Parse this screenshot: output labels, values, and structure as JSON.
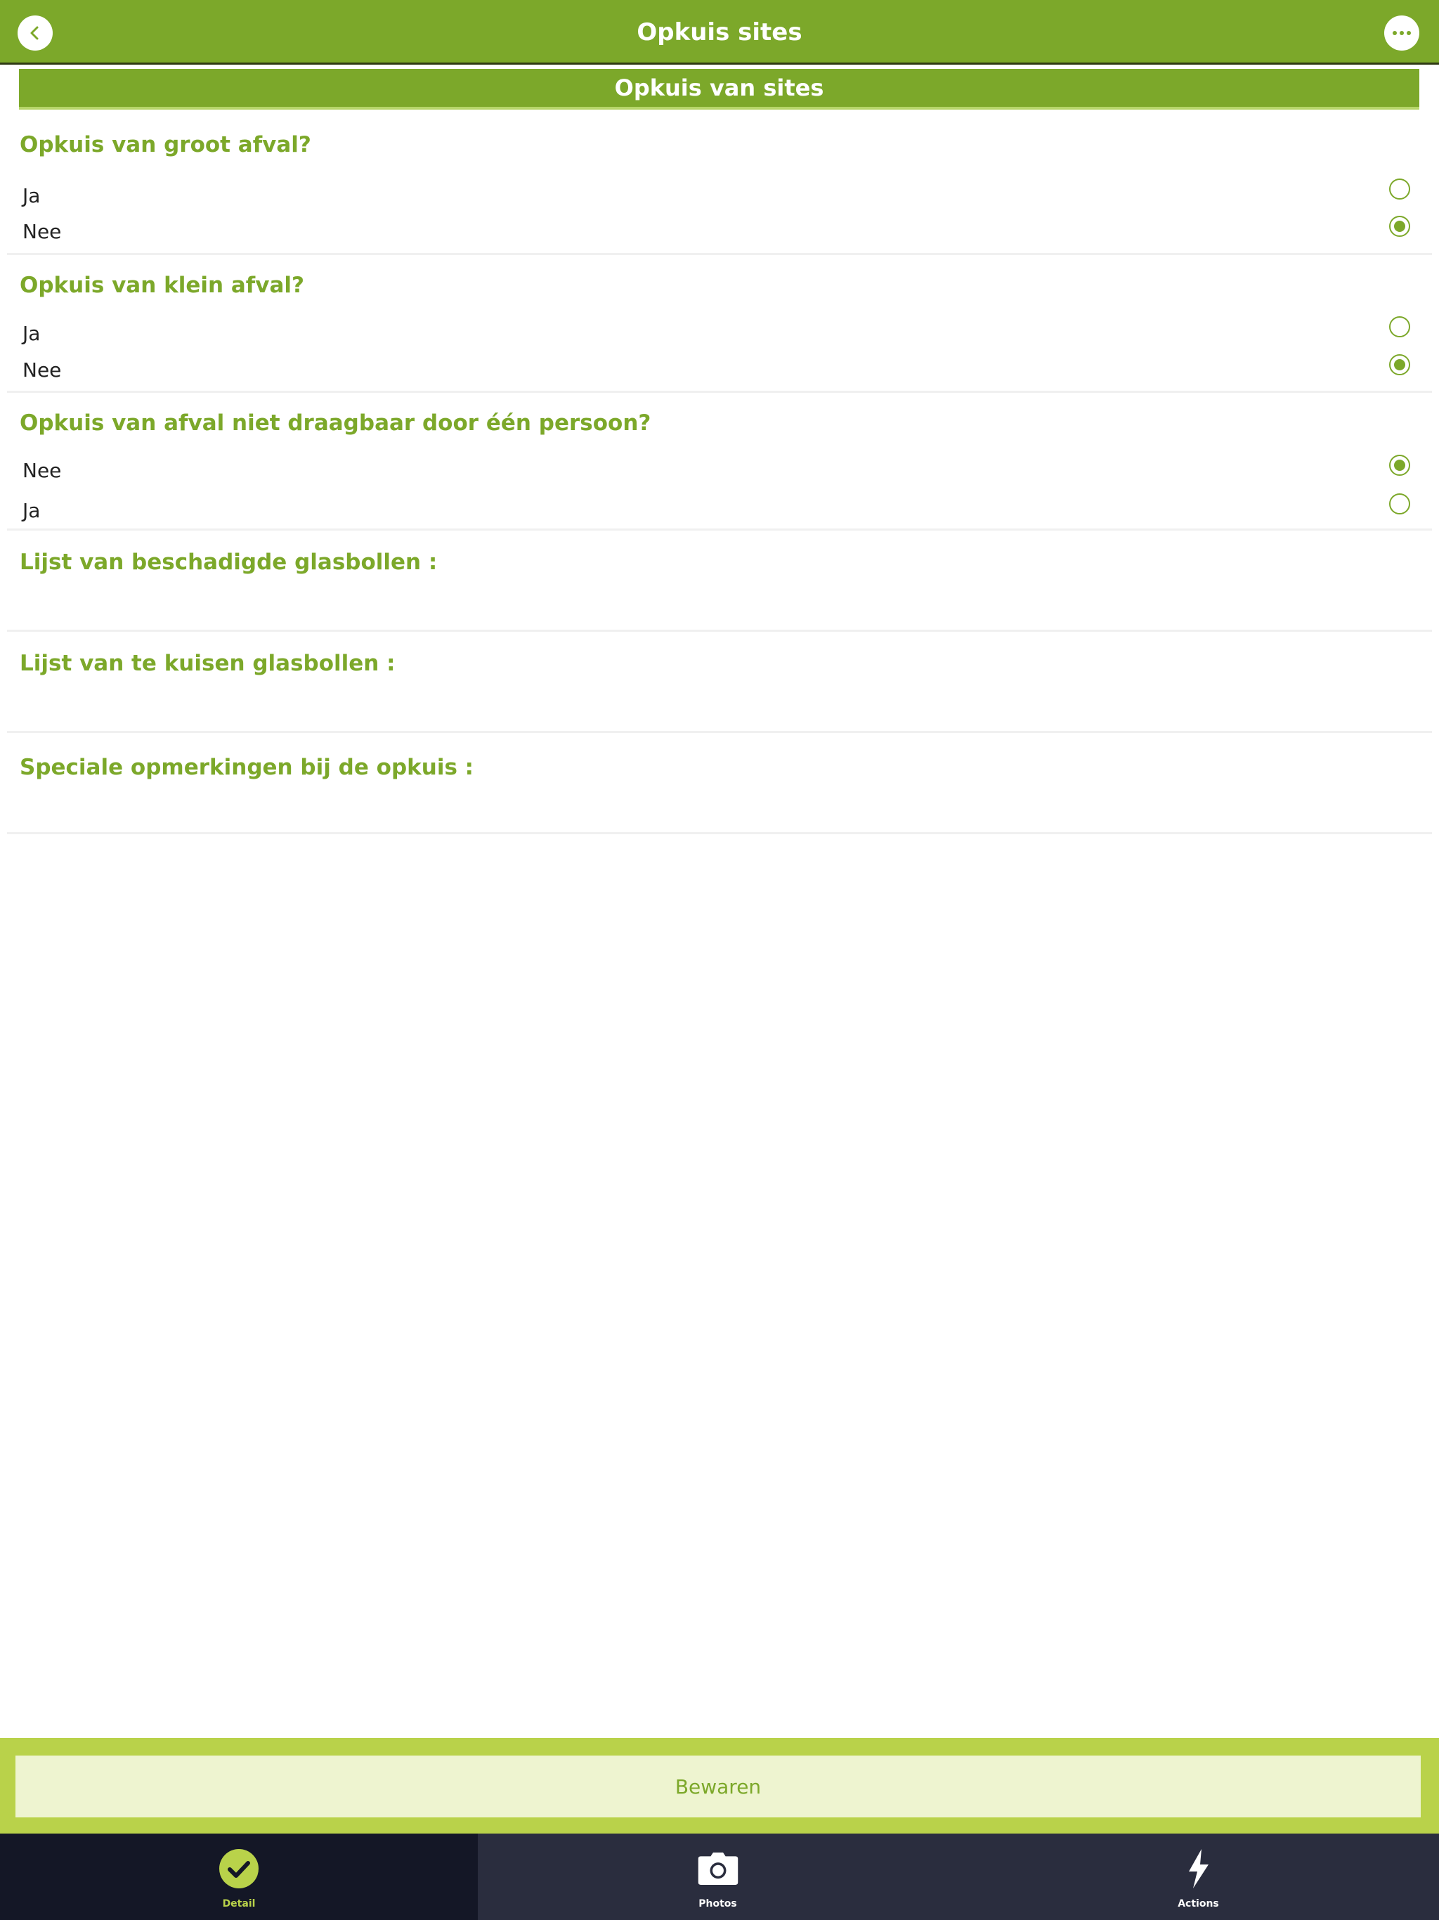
{
  "header": {
    "title": "Opkuis sites"
  },
  "section": {
    "title": "Opkuis van sites"
  },
  "questions": [
    {
      "title": "Opkuis van groot afval?",
      "options": [
        {
          "label": "Ja",
          "selected": false
        },
        {
          "label": "Nee",
          "selected": true
        }
      ]
    },
    {
      "title": "Opkuis van klein afval?",
      "options": [
        {
          "label": "Ja",
          "selected": false
        },
        {
          "label": "Nee",
          "selected": true
        }
      ]
    },
    {
      "title": "Opkuis van afval niet draagbaar door één persoon?",
      "options": [
        {
          "label": "Nee",
          "selected": true
        },
        {
          "label": "Ja",
          "selected": false
        }
      ]
    }
  ],
  "text_fields": [
    {
      "label": "Lijst van beschadigde glasbollen :"
    },
    {
      "label": "Lijst van te kuisen glasbollen :"
    },
    {
      "label": "Speciale opmerkingen bij de opkuis :"
    }
  ],
  "save_label": "Bewaren",
  "tabs": [
    {
      "label": "Detail",
      "icon": "check-circle-icon",
      "active": true
    },
    {
      "label": "Photos",
      "icon": "camera-icon",
      "active": false
    },
    {
      "label": "Actions",
      "icon": "bolt-icon",
      "active": false
    }
  ],
  "colors": {
    "primary": "#7ca82a",
    "accent": "#b9d24a",
    "tabbar": "#2a2d3e"
  }
}
